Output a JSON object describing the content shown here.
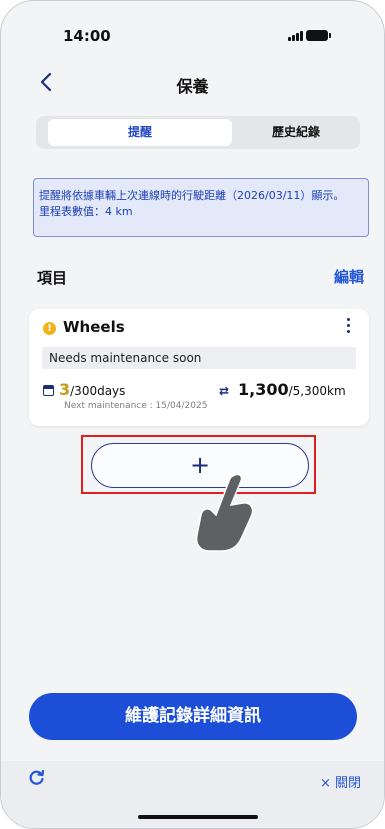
{
  "status_bar": {
    "time": "14:00"
  },
  "header": {
    "back_icon": "chevron-left-icon",
    "title": "保養"
  },
  "tabs": [
    {
      "label": "提醒",
      "active": true
    },
    {
      "label": "歷史紀錄",
      "active": false
    }
  ],
  "notice": {
    "line1": "提醒將依據車輛上次連線時的行駛距離（2026/03/11）顯示。",
    "line2": "里程表數值：4 km"
  },
  "section": {
    "title": "項目",
    "edit_label": "編輯"
  },
  "item": {
    "name": "Wheels",
    "status": "Needs maintenance soon",
    "days_value": "3",
    "days_total": "/300days",
    "km_value": "1,300",
    "km_total": "/5,300km",
    "next_maintenance": "Next maintenance : 15/04/2025"
  },
  "add_button": {
    "symbol": "+"
  },
  "details_button": {
    "label": "維護記錄詳細資訊"
  },
  "footer": {
    "refresh_icon": "refresh-icon",
    "close_label": "× 關閉"
  },
  "colors": {
    "primary": "#1d4ed8",
    "accent_text": "#2456d6",
    "warning": "#f0b31b",
    "highlight": "#e02020"
  }
}
